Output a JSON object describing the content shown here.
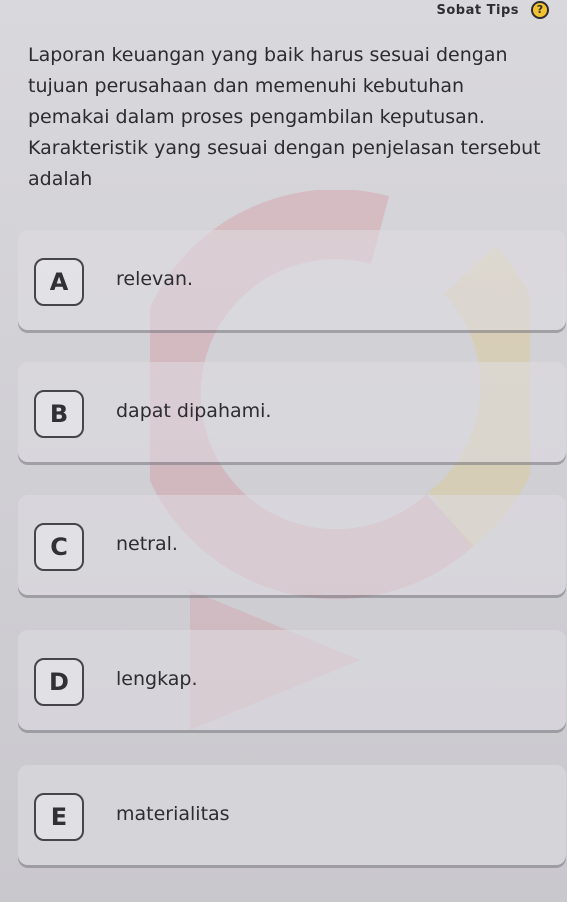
{
  "header": {
    "tips_label": "Sobat Tips",
    "tips_icon": "question-mark-icon",
    "tips_icon_glyph": "?"
  },
  "question": {
    "text": "Laporan keuangan yang baik harus sesuai dengan tujuan perusahaan dan memenuhi kebutuhan pemakai dalam proses pengambilan keputusan. Karakteristik yang sesuai dengan penjelasan tersebut adalah"
  },
  "options": [
    {
      "letter": "A",
      "text": "relevan."
    },
    {
      "letter": "B",
      "text": "dapat dipahami."
    },
    {
      "letter": "C",
      "text": "netral."
    },
    {
      "letter": "D",
      "text": "lengkap."
    },
    {
      "letter": "E",
      "text": "materialitas"
    }
  ],
  "colors": {
    "background": "#d6d5da",
    "text": "#2c2c30",
    "tips_icon_fill": "#f2c230",
    "watermark_red": "#d86b73",
    "watermark_yellow": "#e8c65a"
  }
}
